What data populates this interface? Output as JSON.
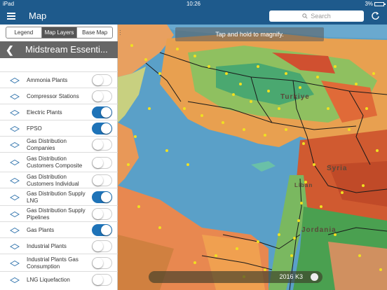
{
  "status_bar": {
    "carrier": "iPad",
    "time": "10:26",
    "battery": "3%"
  },
  "nav": {
    "title": "Map",
    "search_placeholder": "Search"
  },
  "panel": {
    "tabs": [
      {
        "label": "Legend",
        "active": false
      },
      {
        "label": "Map Layers",
        "active": true
      },
      {
        "label": "Base Map",
        "active": false
      }
    ],
    "title": "Midstream Essenti...",
    "layers": [
      {
        "label": "Ammonia Plants",
        "on": false
      },
      {
        "label": "Compressor Stations",
        "on": false
      },
      {
        "label": "Electric Plants",
        "on": true
      },
      {
        "label": "FPSO",
        "on": true
      },
      {
        "label": "Gas Distribution Companies",
        "on": false
      },
      {
        "label": "Gas Distribution Customers Composite",
        "on": false
      },
      {
        "label": "Gas Distribution Customers Individual",
        "on": false
      },
      {
        "label": "Gas Distribution Supply LNG",
        "on": true
      },
      {
        "label": "Gas Distribution Supply Pipelines",
        "on": false
      },
      {
        "label": "Gas Plants",
        "on": true
      },
      {
        "label": "Industrial Plants",
        "on": false
      },
      {
        "label": "Industrial Plants Gas Consumption",
        "on": false
      },
      {
        "label": "LNG Liquefaction",
        "on": false
      }
    ]
  },
  "map": {
    "hint": "Tap and hold to magnify.",
    "labels": {
      "turkey": "Turkiye",
      "syria": "Syria",
      "jordan": "Jordania",
      "lebanon": "Liban"
    },
    "timeline_label": "2016 K3"
  },
  "colors": {
    "bar": "#1e5a8c",
    "toggle_on": "#1e73b8",
    "sea": "#5aa0c8"
  }
}
